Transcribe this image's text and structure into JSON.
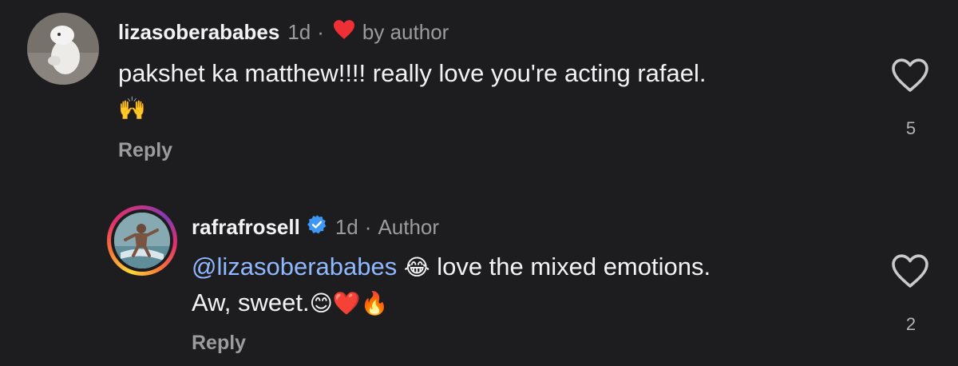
{
  "comments": [
    {
      "username": "lizasoberababes",
      "time": "1d",
      "separator": "·",
      "badge_icon": "red-heart-icon",
      "badge_text": "by author",
      "text_line1": "pakshet ka matthew!!!! really love you're acting rafael.",
      "text_line2": "🙌",
      "reply_label": "Reply",
      "like_icon": "heart-outline-icon",
      "like_count": "5"
    },
    {
      "username": "rafrafrosell",
      "verified_icon": "verified-badge-icon",
      "time": "1d",
      "separator": "·",
      "role": "Author",
      "mention": "@lizasoberababes",
      "emoji_laugh": "😂",
      "text_line1": "love the mixed emotions.",
      "text_line2": "Aw, sweet.",
      "emoji_end": "😊❤️🔥",
      "reply_label": "Reply",
      "like_icon": "heart-outline-icon",
      "like_count": "2"
    }
  ],
  "colors": {
    "background": "#1d1d20",
    "text": "#f2f2f2",
    "muted": "#9b9ba0",
    "mention": "#8fb8ff",
    "heart_badge": "#ef2f36",
    "verified": "#3d98f5"
  }
}
